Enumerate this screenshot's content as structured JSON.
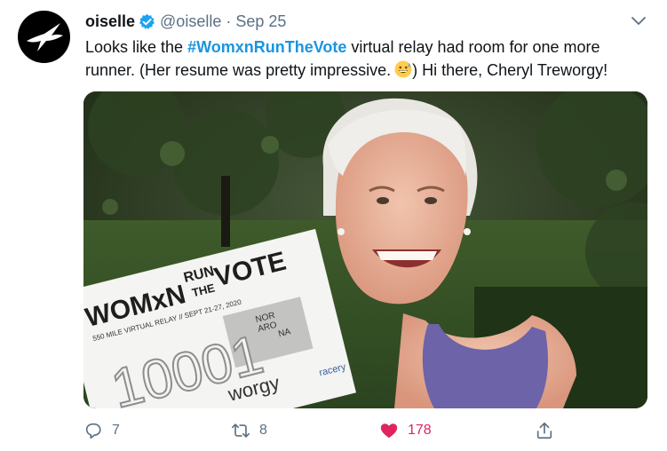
{
  "tweet": {
    "author_name": "oiselle",
    "handle": "@oiselle",
    "separator": "·",
    "date": "Sep 25",
    "text_before": "Looks like the ",
    "hashtag": "#WomxnRunTheVote",
    "text_after": " virtual relay had room for one more runner. (Her resume was pretty impressive.",
    "text_end": ") Hi there, Cheryl Treworgy!"
  },
  "photo": {
    "sign_run": "RUN",
    "sign_the": "THE",
    "sign_vote": "VOTE",
    "sign_womxn": "WOMxN",
    "sign_subtitle": "550 MILE VIRTUAL RELAY // SEPT 21-27, 2020",
    "bib_number": "10001",
    "bib_name": "worgy",
    "sponsor": "racery",
    "map_label_1": "NOR",
    "map_label_2": "ARO",
    "map_label_3": "NA"
  },
  "actions": {
    "reply_count": "7",
    "retweet_count": "8",
    "like_count": "178"
  },
  "colors": {
    "hashtag": "#1b95e0",
    "verified": "#1da1f2",
    "like": "#e0245e",
    "meta": "#5b7083"
  },
  "icons": [
    "bird-logo-icon",
    "verified-badge-icon",
    "chevron-down-icon",
    "grinning-sweat-emoji-icon",
    "reply-icon",
    "retweet-icon",
    "heart-icon",
    "share-icon"
  ]
}
